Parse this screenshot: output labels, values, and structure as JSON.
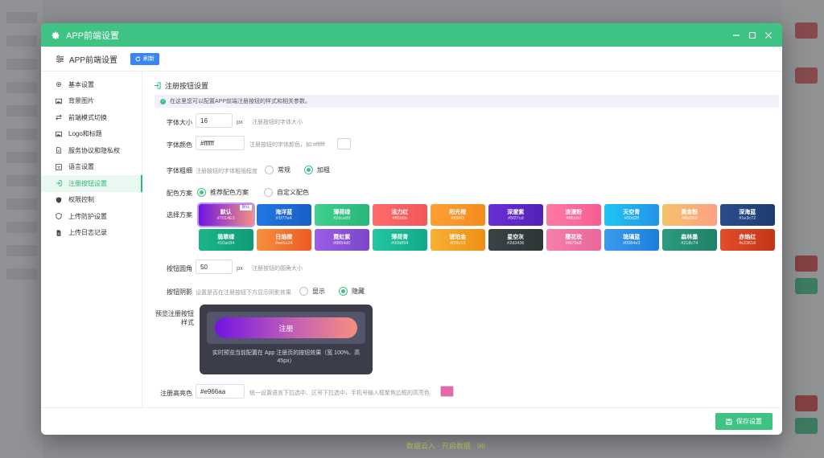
{
  "background": {
    "footer_text": "数据云入 · 开启数据 · 96"
  },
  "window": {
    "title": "APP前端设置",
    "header_color": "#3fc384"
  },
  "toolbar": {
    "title": "APP前端设置",
    "refresh_label": "刷新"
  },
  "sidebar": {
    "items": [
      {
        "label": "基本设置",
        "icon": "gear-icon"
      },
      {
        "label": "背景图片",
        "icon": "image-icon"
      },
      {
        "label": "前端模式切换",
        "icon": "swap-icon"
      },
      {
        "label": "Logo和标题",
        "icon": "image-icon"
      },
      {
        "label": "服务协议和隐私权",
        "icon": "document-icon"
      },
      {
        "label": "语言设置",
        "icon": "language-icon"
      },
      {
        "label": "注册按钮设置",
        "icon": "login-icon",
        "active": true
      },
      {
        "label": "权限控制",
        "icon": "shield-icon"
      },
      {
        "label": "上传防护设置",
        "icon": "shield-icon"
      },
      {
        "label": "上传日志记录",
        "icon": "document-icon"
      }
    ]
  },
  "section": {
    "title": "注册按钮设置",
    "notice": "在这里您可以配置APP前端注册按钮的样式和相关参数。"
  },
  "form": {
    "font_size": {
      "label": "字体大小",
      "value": "16",
      "unit": "px",
      "hint": "注册按钮的字体大小"
    },
    "font_color": {
      "label": "字体颜色",
      "value": "#ffffff",
      "hint": "注册按钮的字体颜色，如:#ffffff",
      "swatch": "#ffffff"
    },
    "font_weight": {
      "label": "字体粗细",
      "hint": "注册按钮的字体粗细程度",
      "options": [
        "常规",
        "加粗"
      ],
      "selected": "加粗"
    },
    "color_scheme": {
      "label": "配色方案",
      "options": [
        "推荐配色方案",
        "自定义配色"
      ],
      "selected": "推荐配色方案"
    },
    "scheme_select": {
      "label": "选择方案",
      "default_tag": "默认"
    },
    "radius": {
      "label": "按钮圆角",
      "value": "50",
      "unit": "px",
      "hint": "注册按钮的圆角大小"
    },
    "shadow": {
      "label": "按钮阴影",
      "hint": "设置是否在注册按钮下方显示阴影效果",
      "options": [
        "显示",
        "隐藏"
      ],
      "selected": "隐藏"
    },
    "preview": {
      "label_line1": "预览注册按钮",
      "label_line2": "样式",
      "button_text": "注册",
      "caption": "实时预览当前配置在 App 注册页的按钮效果（宽 100%、高 45px）"
    },
    "highlight": {
      "label": "注册高亮色",
      "value": "#e966aa",
      "hint": "统一设置语言下拉选中、区号下拉选中、手机号输入框聚焦边框的高亮色",
      "swatch": "#e966aa"
    }
  },
  "schemes": [
    {
      "name": "默认",
      "hex": "#7014E2",
      "c1": "#7014e2",
      "c2": "#f58f7f",
      "selected": true
    },
    {
      "name": "海洋蓝",
      "hex": "#1f77e4",
      "c1": "#1f77e4",
      "c2": "#1a5fc4"
    },
    {
      "name": "薄荷绿",
      "hex": "#2dce89",
      "c1": "#3fd08f",
      "c2": "#2ab57a"
    },
    {
      "name": "活力红",
      "hex": "#ff6b6b",
      "c1": "#ff6b6b",
      "c2": "#f0575a"
    },
    {
      "name": "阳光橙",
      "hex": "#ff9f43",
      "c1": "#ffa033",
      "c2": "#f58a1f"
    },
    {
      "name": "深邃紫",
      "hex": "#5f27cd",
      "c1": "#6a2fd6",
      "c2": "#5320b8"
    },
    {
      "name": "浪漫粉",
      "hex": "#ff6b9d",
      "c1": "#ff79a4",
      "c2": "#f65d92"
    },
    {
      "name": "天空青",
      "hex": "#00d2ff",
      "c1": "#1cc6f5",
      "c2": "#2593e8"
    },
    {
      "name": "黄金粉",
      "hex": "#f6d365",
      "c1": "#f6c26a",
      "c2": "#fda085"
    },
    {
      "name": "深海蓝",
      "hex": "#1e3c72",
      "c1": "#2a4d8c",
      "c2": "#1e3c72"
    },
    {
      "name": "翡翠绿",
      "hex": "#10ac84",
      "c1": "#1bb58b",
      "c2": "#0f9c77"
    },
    {
      "name": "日焰橙",
      "hex": "#ee5a24",
      "c1": "#f5903d",
      "c2": "#ee5a24"
    },
    {
      "name": "霓虹紫",
      "hex": "#8854d0",
      "c1": "#9b5de5",
      "c2": "#7b47c9"
    },
    {
      "name": "薄荷青",
      "hex": "#00b894",
      "c1": "#22c7a0",
      "c2": "#12a889"
    },
    {
      "name": "琥珀金",
      "hex": "#f39c12",
      "c1": "#f8b034",
      "c2": "#ee8f16"
    },
    {
      "name": "星空灰",
      "hex": "#2d3436",
      "c1": "#3b4346",
      "c2": "#2d3436"
    },
    {
      "name": "樱花玫",
      "hex": "#fd79a8",
      "c1": "#f77fab",
      "c2": "#e9679a"
    },
    {
      "name": "琉璃蓝",
      "hex": "#0984e3",
      "c1": "#3c9bee",
      "c2": "#1a7fdc"
    },
    {
      "name": "森林墨",
      "hex": "#218c74",
      "c1": "#2b9c80",
      "c2": "#1f8169"
    },
    {
      "name": "赤焰红",
      "hex": "#c23616",
      "c1": "#e34d2b",
      "c2": "#c23616"
    }
  ],
  "footer": {
    "save_label": "保存设置"
  }
}
